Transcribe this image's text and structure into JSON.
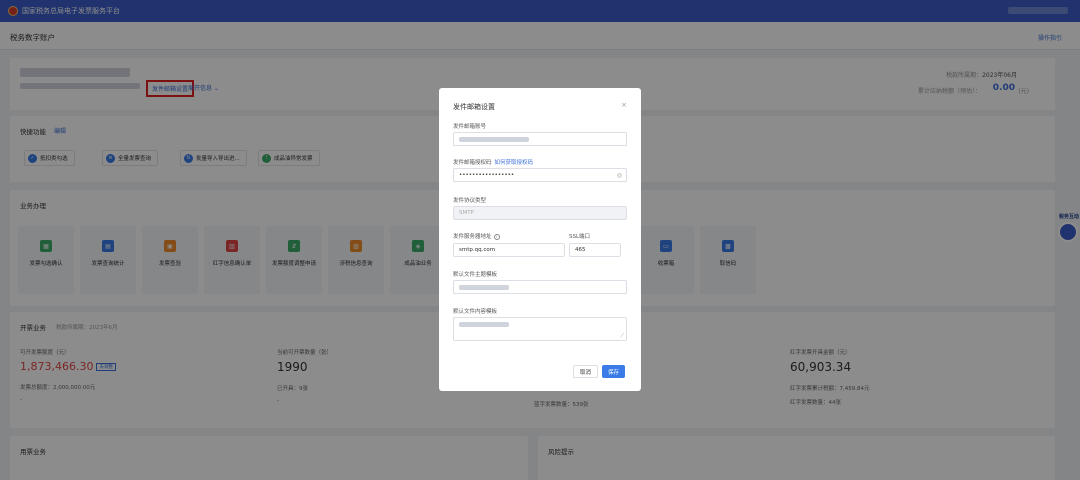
{
  "topbar": {
    "title": "国家税务总局电子发票服务平台"
  },
  "page": {
    "title": "税务数字账户",
    "guide_label": "操作指引"
  },
  "company": {
    "mail_settings_link": "发件邮箱设置",
    "expand_link": "展开信息 ⌄",
    "period_label": "税款所属期：",
    "period_value": "2023年06月",
    "tax_label": "累计应纳税额（预估）：",
    "tax_value": "0.00",
    "tax_unit": "(元)"
  },
  "quick": {
    "title": "快捷功能",
    "edit_label": "编辑",
    "items": [
      {
        "label": "抵扣类勾选",
        "color": "#3a7be8"
      },
      {
        "label": "全量发票查询",
        "color": "#3a7be8"
      },
      {
        "label": "批量导入导出进...",
        "color": "#3a7be8"
      },
      {
        "label": "成品油异常发票",
        "color": "#3bae6a"
      }
    ]
  },
  "business": {
    "title": "业务办理",
    "tiles": [
      {
        "label": "发票勾选确认",
        "icon": "check-grid-icon",
        "color": "#3bae6a"
      },
      {
        "label": "发票查询统计",
        "icon": "stats-icon",
        "color": "#3a7be8"
      },
      {
        "label": "发票查验",
        "icon": "verify-icon",
        "color": "#f08a2a"
      },
      {
        "label": "红字信息确认单",
        "icon": "red-form-icon",
        "color": "#e04646"
      },
      {
        "label": "发票额度调整申请",
        "icon": "quota-icon",
        "color": "#3bae6a"
      },
      {
        "label": "涉税信息查询",
        "icon": "search-doc-icon",
        "color": "#f08a2a"
      },
      {
        "label": "成品油业务",
        "icon": "oil-icon",
        "color": "#3bae6a"
      },
      {
        "label": "",
        "icon": "hidden-icon",
        "color": "#3a7be8"
      },
      {
        "label": "",
        "icon": "hidden-icon",
        "color": "#3a7be8"
      },
      {
        "label": "",
        "icon": "hidden-icon",
        "color": "#3a7be8"
      },
      {
        "label": "收票箱",
        "icon": "inbox-icon",
        "color": "#3a7be8"
      },
      {
        "label": "取信码",
        "icon": "code-icon",
        "color": "#3a7be8"
      }
    ]
  },
  "issue": {
    "title": "开票业务",
    "subtitle": "税款所属期：2023年6月",
    "stats": [
      {
        "label": "可开发票额度（元）",
        "value": "1,873,466.30",
        "badge": "去调整",
        "line": "发票总额度：2,000,000.00元",
        "line2": "-"
      },
      {
        "label": "当前可开票数量（张）",
        "value": "1990",
        "line": "已开具：9张",
        "line2": "-"
      },
      {
        "label": "",
        "value": "",
        "line": "蓝字发票数量：539张",
        "line2": ""
      },
      {
        "label": "红字发票开具金额（元）",
        "value": "60,903.34",
        "line": "红字发票累计税额：7,459.84元",
        "line2": "红字发票数量：44张"
      }
    ]
  },
  "bottom": {
    "left_title": "用票业务",
    "right_title": "风险提示"
  },
  "modal": {
    "title": "发件邮箱设置",
    "close": "×",
    "account_label": "发件邮箱账号",
    "auth_label": "发件邮箱授权码",
    "auth_link": "如何获取授权码",
    "auth_value": "•••••••••••••••••",
    "protocol_label": "发件协议类型",
    "protocol_value": "SMTP",
    "server_label": "发件服务器地址",
    "server_value": "smtp.qq.com",
    "port_label": "SSL端口",
    "port_value": "465",
    "subject_label": "默认文件主题模板",
    "content_label": "默认文件内容模板",
    "cancel": "取消",
    "save": "保存"
  },
  "widget": {
    "text": "税务互动"
  }
}
